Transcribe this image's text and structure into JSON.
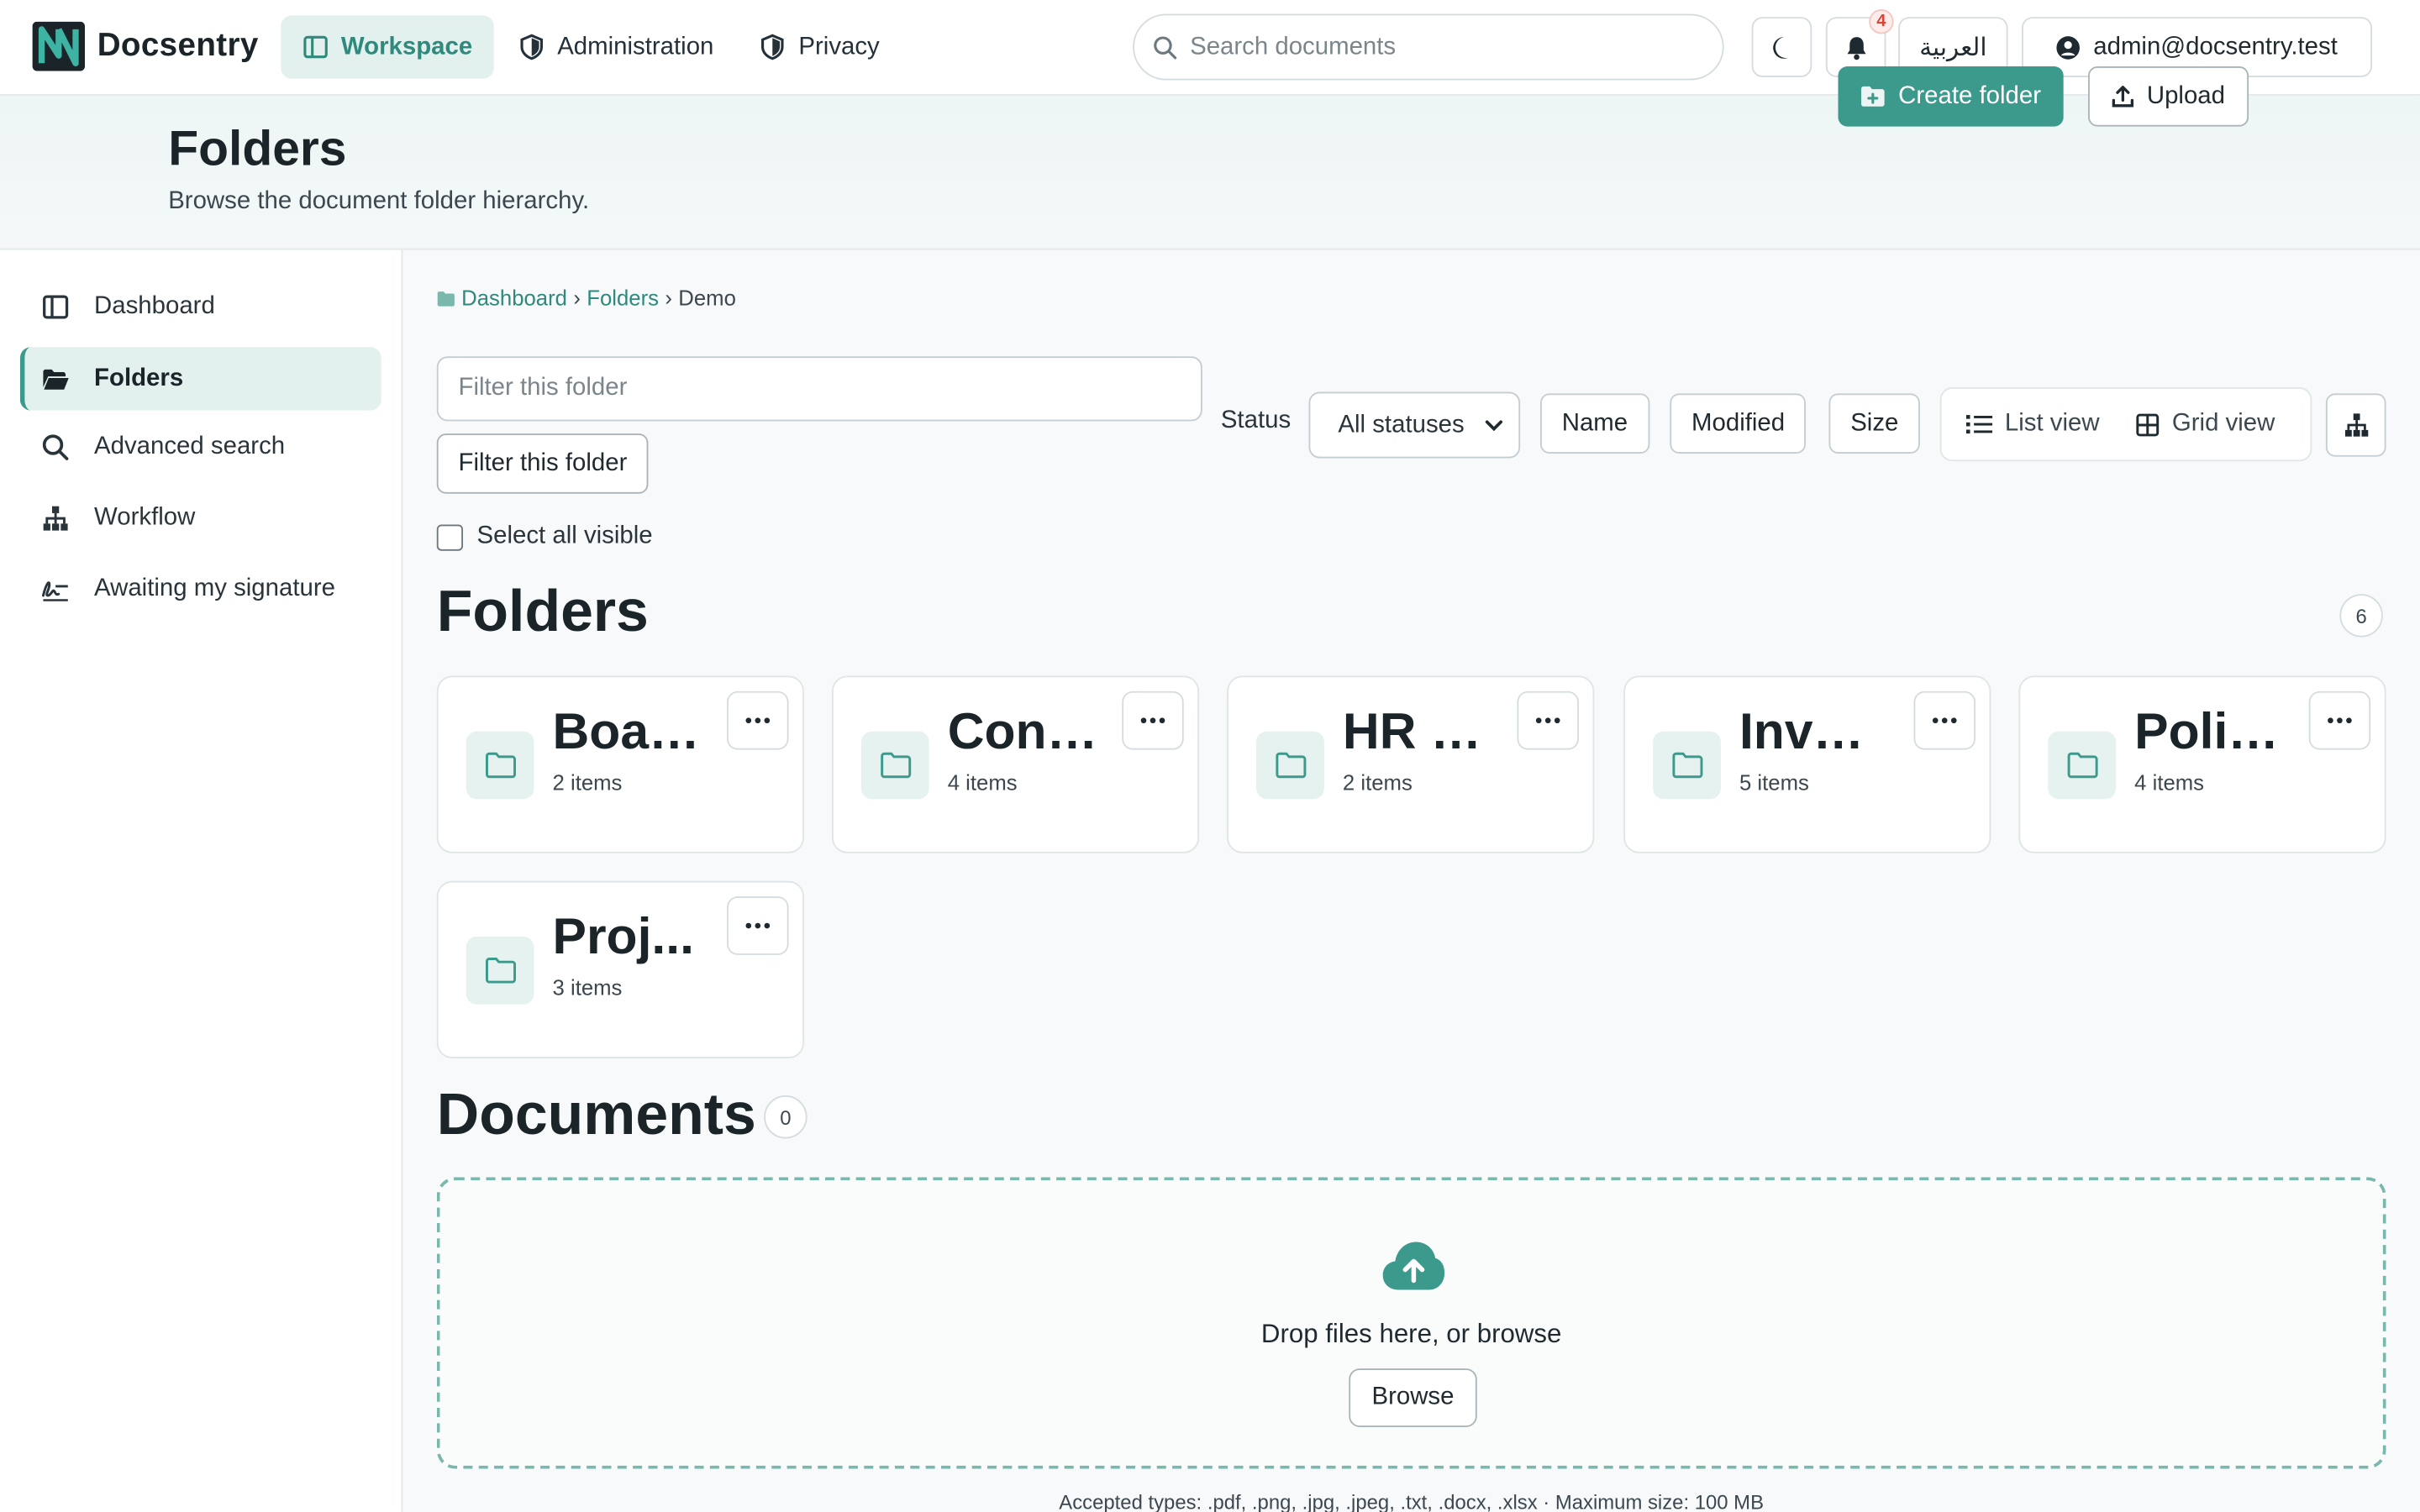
{
  "app": {
    "name": "Docsentry"
  },
  "topnav": [
    {
      "label": "Workspace",
      "icon": "layout-icon",
      "active": true
    },
    {
      "label": "Administration",
      "icon": "shield-icon",
      "active": false
    },
    {
      "label": "Privacy",
      "icon": "shield-icon",
      "active": false
    }
  ],
  "search": {
    "placeholder": "Search documents",
    "value": ""
  },
  "notifications": {
    "count": "4"
  },
  "language": {
    "label": "العربية"
  },
  "user": {
    "email": "admin@docsentry.test"
  },
  "header": {
    "title": "Folders",
    "subtitle": "Browse the document folder hierarchy.",
    "create_label": "Create folder",
    "upload_label": "Upload"
  },
  "sidebar": {
    "items": [
      {
        "label": "Dashboard",
        "icon": "layout-icon",
        "active": false
      },
      {
        "label": "Folders",
        "icon": "folder-open-icon",
        "active": true
      },
      {
        "label": "Advanced search",
        "icon": "search-icon",
        "active": false
      },
      {
        "label": "Workflow",
        "icon": "sitemap-icon",
        "active": false
      },
      {
        "label": "Awaiting my signature",
        "icon": "signature-icon",
        "active": false
      }
    ]
  },
  "breadcrumb": {
    "items": [
      "Dashboard",
      "Folders"
    ],
    "current": "Demo"
  },
  "filter": {
    "placeholder": "Filter this folder",
    "value": "",
    "button_label": "Filter this folder",
    "status_label": "Status",
    "status_value": "All statuses"
  },
  "sort": {
    "name": "Name",
    "modified": "Modified",
    "size": "Size"
  },
  "views": {
    "list": "List view",
    "grid": "Grid view"
  },
  "select_all": {
    "label": "Select all visible",
    "checked": false
  },
  "folders": {
    "title": "Folders",
    "count": "6",
    "items": [
      {
        "name": "Boar...",
        "count": "2 items"
      },
      {
        "name": "Cont...",
        "count": "4 items"
      },
      {
        "name": "HR R...",
        "count": "2 items"
      },
      {
        "name": "Invoi...",
        "count": "5 items"
      },
      {
        "name": "Polic...",
        "count": "4 items"
      },
      {
        "name": "Proj...",
        "count": "3 items"
      }
    ]
  },
  "documents": {
    "title": "Documents",
    "count": "0",
    "drop_text": "Drop files here, or browse",
    "browse_label": "Browse",
    "accepted": "Accepted types: .pdf, .png, .jpg, .jpeg, .txt, .docx, .xlsx · Maximum size: 100 MB"
  },
  "colors": {
    "accent": "#3c9a8c",
    "accent_light": "#e2f0ee",
    "badge": "#d8463a"
  }
}
